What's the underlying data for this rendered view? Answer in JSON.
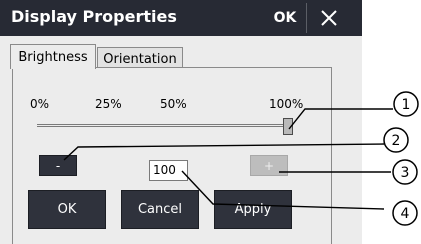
{
  "window": {
    "title": "Display Properties",
    "ok_label": "OK",
    "close_icon": "close-icon"
  },
  "tabs": [
    {
      "label": "Brightness",
      "active": true
    },
    {
      "label": "Orientation",
      "active": false
    }
  ],
  "scale": {
    "labels": [
      "0%",
      "25%",
      "50%",
      "100%"
    ]
  },
  "brightness": {
    "value": "100",
    "slider_fraction": 1.0,
    "decrease_label": "-",
    "increase_label": "+",
    "increase_enabled": false
  },
  "buttons": {
    "ok": "OK",
    "cancel": "Cancel",
    "apply": "Apply"
  },
  "callouts": [
    "1",
    "2",
    "3",
    "4"
  ],
  "colors": {
    "titlebar": "#272a34",
    "button_dark": "#2f323c",
    "button_disabled": "#bdbdbd",
    "window_bg": "#ececec"
  }
}
